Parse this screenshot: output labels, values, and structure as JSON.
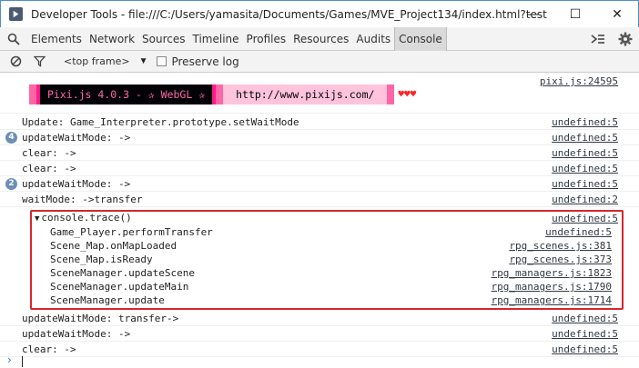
{
  "window": {
    "title": "Developer Tools - file:///C:/Users/yamasita/Documents/Games/MVE_Project134/index.html?test",
    "minimize": "—",
    "maximize": "☐",
    "close": "✕"
  },
  "tabs": [
    "Elements",
    "Network",
    "Sources",
    "Timeline",
    "Profiles",
    "Resources",
    "Audits",
    "Console"
  ],
  "active_tab": "Console",
  "toolbar": {
    "frame": "<top frame>",
    "preserve_log": "Preserve log"
  },
  "pixi": {
    "banner": "Pixi.js 4.0.3 - ✰ WebGL ✰",
    "url": "http://www.pixijs.com/",
    "hearts": "♥♥♥",
    "source": "pixi.js:24595"
  },
  "logs": [
    {
      "badge": "",
      "text": "Update: Game_Interpreter.prototype.setWaitMode",
      "source": "undefined:5"
    },
    {
      "badge": "4",
      "text": "updateWaitMode: ->",
      "source": "undefined:5"
    },
    {
      "badge": "",
      "text": "clear: ->",
      "source": "undefined:5"
    },
    {
      "badge": "",
      "text": "clear: ->",
      "source": "undefined:5"
    },
    {
      "badge": "2",
      "text": "updateWaitMode: ->",
      "source": "undefined:5"
    },
    {
      "badge": "",
      "text": "waitMode: ->transfer",
      "source": "undefined:2"
    }
  ],
  "trace": {
    "title": "console.trace()",
    "source": "undefined:5",
    "frames": [
      {
        "fn": "Game_Player.performTransfer",
        "source": "undefined:5"
      },
      {
        "fn": "Scene_Map.onMapLoaded",
        "source": "rpg_scenes.js:381"
      },
      {
        "fn": "Scene_Map.isReady",
        "source": "rpg_scenes.js:373"
      },
      {
        "fn": "SceneManager.updateScene",
        "source": "rpg_managers.js:1823"
      },
      {
        "fn": "SceneManager.updateMain",
        "source": "rpg_managers.js:1790"
      },
      {
        "fn": "SceneManager.update",
        "source": "rpg_managers.js:1714"
      }
    ]
  },
  "logs_after": [
    {
      "text": "updateWaitMode: transfer->",
      "source": "undefined:5"
    },
    {
      "text": "updateWaitMode: ->",
      "source": "undefined:5"
    },
    {
      "text": "clear: ->",
      "source": "undefined:5"
    }
  ],
  "prompt": "›"
}
